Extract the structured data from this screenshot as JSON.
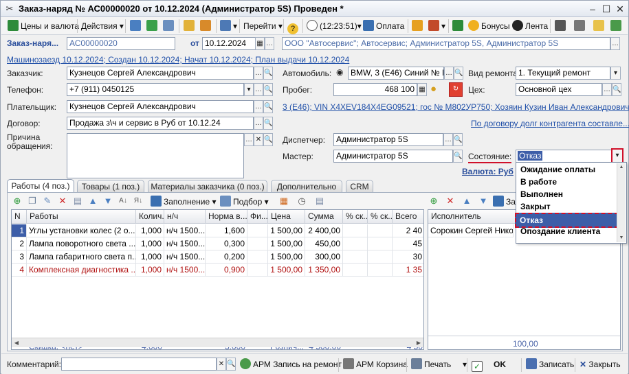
{
  "window": {
    "title": "Заказ-наряд № АС00000020 от 10.12.2024 (Администратор 5S) Проведен *"
  },
  "toolbar": {
    "prices": "Цены и валюта",
    "actions": "Действия",
    "goto": "Перейти",
    "time": "(12:23:51)",
    "payment": "Оплата",
    "bonuses": "Бонусы",
    "tape": "Лента"
  },
  "header": {
    "doc_label": "Заказ-наря...",
    "number": "АС00000020",
    "from_label": "от",
    "date": "10.12.2024",
    "organization": "ООО \"Автосервис\"; Автосервис; Администратор 5S, Администратор 5S",
    "history_link": "Машинозаезд 10.12.2024; Создан 10.12.2024; Начат 10.12.2024; План выдачи 10.12.2024"
  },
  "form": {
    "customer_label": "Заказчик:",
    "customer": "Кузнецов Сергей Александрович",
    "phone_label": "Телефон:",
    "phone": "+7 (911) 0450125",
    "payer_label": "Плательщик:",
    "payer": "Кузнецов Сергей Александрович",
    "contract_label": "Договор:",
    "contract": "Продажа з\\ч и сервис в Руб от 10.12.24",
    "reason_label": "Причина обращения:",
    "car_label": "Автомобиль:",
    "car": "BMW, 3 (E46) Синий № М8",
    "mileage_label": "Пробег:",
    "mileage": "468 100",
    "car_link": "3 (E46); VIN X4XEV184X4EG09521; гос № М802УР750; Хозяин Кузин Иван Александрович",
    "dispatcher_label": "Диспетчер:",
    "dispatcher": "Администратор 5S",
    "master_label": "Мастер:",
    "master": "Администратор 5S",
    "repair_type_label": "Вид ремонта:",
    "repair_type": "1. Текущий ремонт",
    "shop_label": "Цех:",
    "shop": "Основной цех",
    "debt_link": "По договору долг контрагента составле...",
    "state_label": "Состояние:",
    "state": "Отказ",
    "currency_link": "Валюта: Руб"
  },
  "tabs": [
    {
      "label": "Работы (4 поз.)"
    },
    {
      "label": "Товары (1 поз.)"
    },
    {
      "label": "Материалы заказчика (0 поз.)"
    },
    {
      "label": "Дополнительно"
    },
    {
      "label": "CRM"
    }
  ],
  "works_toolbar": {
    "fill": "Заполнение",
    "select": "Подбор"
  },
  "works": {
    "columns": [
      "N",
      "Работы",
      "Колич...",
      "н/ч",
      "Норма в...",
      "Фи...",
      "Цена",
      "Сумма",
      "% ск...",
      "% ск...",
      "Всего"
    ],
    "rows": [
      {
        "n": "1",
        "name": "Углы установки колес (2 о...",
        "qty": "1,000",
        "unit": "н/ч 1500...",
        "norm": "1,600",
        "fi": "",
        "price": "1 500,00",
        "sum": "2 400,00",
        "d1": "",
        "d2": "",
        "total": "2 40"
      },
      {
        "n": "2",
        "name": "Лампа поворотного света ...",
        "qty": "1,000",
        "unit": "н/ч 1500...",
        "norm": "0,300",
        "fi": "",
        "price": "1 500,00",
        "sum": "450,00",
        "d1": "",
        "d2": "",
        "total": "45"
      },
      {
        "n": "3",
        "name": "Лампа габаритного света п...",
        "qty": "1,000",
        "unit": "н/ч 1500...",
        "norm": "0,200",
        "fi": "",
        "price": "1 500,00",
        "sum": "300,00",
        "d1": "",
        "d2": "",
        "total": "30"
      },
      {
        "n": "4",
        "name": "Комплексная диагностика ...",
        "qty": "1,000",
        "unit": "н/ч 1500...",
        "norm": "0,900",
        "fi": "",
        "price": "1 500,00",
        "sum": "1 350,00",
        "d1": "",
        "d2": "",
        "total": "1 35"
      }
    ],
    "footer": {
      "discount": "Скидка: <нет>",
      "qty": "4,000",
      "norm": "3,000",
      "price": "Рознич...",
      "sum": "4 500,00",
      "total": "4 50"
    }
  },
  "executors": {
    "toolbar_label": "За",
    "column": "Исполнитель",
    "rows": [
      {
        "name": "Сорокин Сергей Нико..."
      }
    ],
    "footer": "100,00"
  },
  "state_dropdown": {
    "options": [
      "Ожидание оплаты",
      "В работе",
      "Выполнен",
      "Закрыт",
      "Отказ",
      "Опоздание клиента"
    ]
  },
  "bottom": {
    "comment_label": "Комментарий:",
    "arm_repair": "АРМ Запись на ремонт",
    "arm_cart": "АРМ Корзина",
    "print": "Печать",
    "ok": "OK",
    "save": "Записать",
    "close": "Закрыть"
  }
}
